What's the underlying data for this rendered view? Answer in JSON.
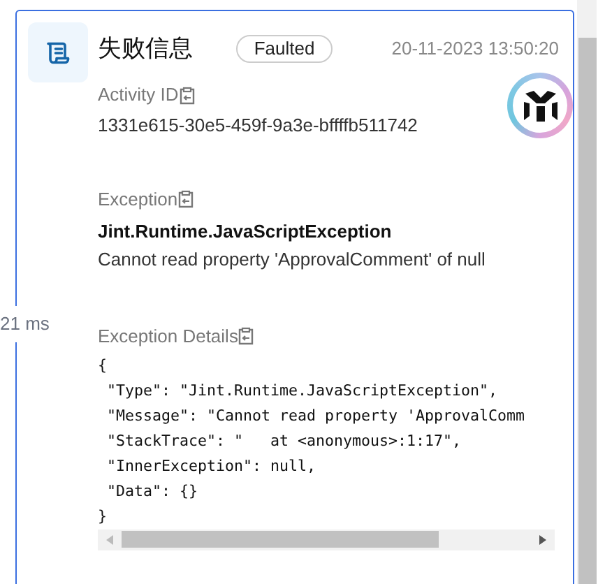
{
  "title": "失败信息",
  "status": {
    "label": "Faulted"
  },
  "timestamp": "20-11-2023 13:50:20",
  "duration": "21 ms",
  "fields": [
    {
      "kind": "plain",
      "label": "Activity ID",
      "value": "1331e615-30e5-459f-9a3e-bffffb511742"
    },
    {
      "kind": "exception",
      "label": "Exception",
      "type": "Jint.Runtime.JavaScriptException",
      "value": "Cannot read property 'ApprovalComment' of null"
    },
    {
      "kind": "code",
      "label": "Exception Details",
      "lines": [
        "{",
        " \"Type\": \"Jint.Runtime.JavaScriptException\",",
        " \"Message\": \"Cannot read property 'ApprovalComm",
        " \"StackTrace\": \"   at <anonymous>:1:17\",",
        " \"InnerException\": null,",
        " \"Data\": {}",
        "}"
      ]
    }
  ]
}
